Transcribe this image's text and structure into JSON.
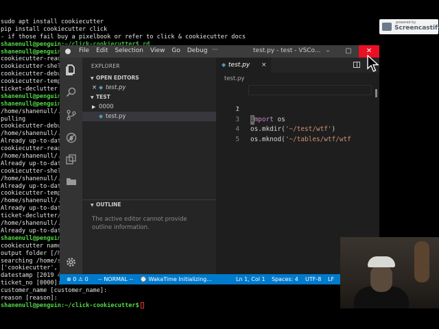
{
  "terminal": {
    "lines": [
      "sudo apt install cookiecutter",
      "pip install cookiecutter click",
      "- if those fail buy a pixelbook or refer to click & cookiecutter docs",
      "shanenull@penguin:~/click-cookiecutter$ rd",
      "shanenull@penguin:",
      "cookiecutter-readm",
      "cookiecutter-shell",
      "cookiecutter-debug",
      "cookiecutter-templ",
      "ticket-declutter",
      "shanenull@penguin:",
      "shanenull@penguin:",
      "/home/shanenull/.c",
      "pulling",
      "cookiecutter-debug",
      "/home/shanenull/.c",
      "Already up-to-date",
      "cookiecutter-readm",
      "/home/shanenull/.c",
      "Already up-to-date",
      "cookiecutter-shell",
      "/home/shanenull/.c",
      "Already up-to-date",
      "cookiecutter-templ",
      "/home/shanenull/.c",
      "Already up-to-date",
      "ticket-declutter/.",
      "/home/shanenull/.c",
      "Already up-to-date",
      "shanenull@penguin:",
      "cookiecutter name",
      "output folder [/ho",
      "searching /home/sh",
      "['cookiecutter', u",
      "datestamp [2019 43",
      "ticket_no [0000]:",
      "customer_name [customer_name]:",
      "reason [reason]:",
      "shanenull@penguin:~/click-cookiecutter$"
    ]
  },
  "badge": {
    "small": "powered by",
    "brand": "Screencastify"
  },
  "window": {
    "menu": [
      "File",
      "Edit",
      "Selection",
      "View",
      "Go",
      "Debug"
    ],
    "more": "···",
    "title": "test.py - test - VSCo...",
    "min": "–",
    "max": "▢",
    "close": "✕"
  },
  "sidebar": {
    "header": "EXPLORER",
    "open_editors": "OPEN EDITORS",
    "open_file": "test.py",
    "folder": "TEST",
    "tree": [
      "0000",
      "test.py"
    ],
    "outline": "OUTLINE",
    "outline_msg": "The active editor cannot provide outline information."
  },
  "editor": {
    "tab": "test.py",
    "tab_close": "×",
    "breadcrumb": "test.py",
    "lines": [
      {
        "n": "1",
        "kw": "import",
        "rest": " os"
      },
      {
        "n": "2",
        "kw": "",
        "rest": ""
      },
      {
        "n": "3",
        "kw": "",
        "rest": "os.mkdir(",
        "str": "'~/test/wtf'",
        "end": ")"
      },
      {
        "n": "4",
        "kw": "",
        "rest": "os.mknod(",
        "str": "'~/tables/wtf/wtf",
        "end": ""
      },
      {
        "n": "5",
        "kw": "",
        "rest": ""
      }
    ]
  },
  "status": {
    "problems": "⊗ 0 ⚠ 0",
    "mode": "-- NORMAL --",
    "wakatime": "⌚ WakaTime Initializing...",
    "position": "Ln 1, Col 1",
    "spaces": "Spaces: 4",
    "encoding": "UTF-8",
    "eol": "LF"
  },
  "icons": {
    "files": "files-icon",
    "search": "search-icon",
    "scm": "source-control-icon",
    "debug": "debug-icon",
    "extensions": "extensions-icon",
    "folder": "folder-icon",
    "settings": "gear-icon"
  },
  "colors": {
    "statusbar": "#007acc",
    "close_button": "#e81123",
    "prompt": "#55d84a"
  }
}
